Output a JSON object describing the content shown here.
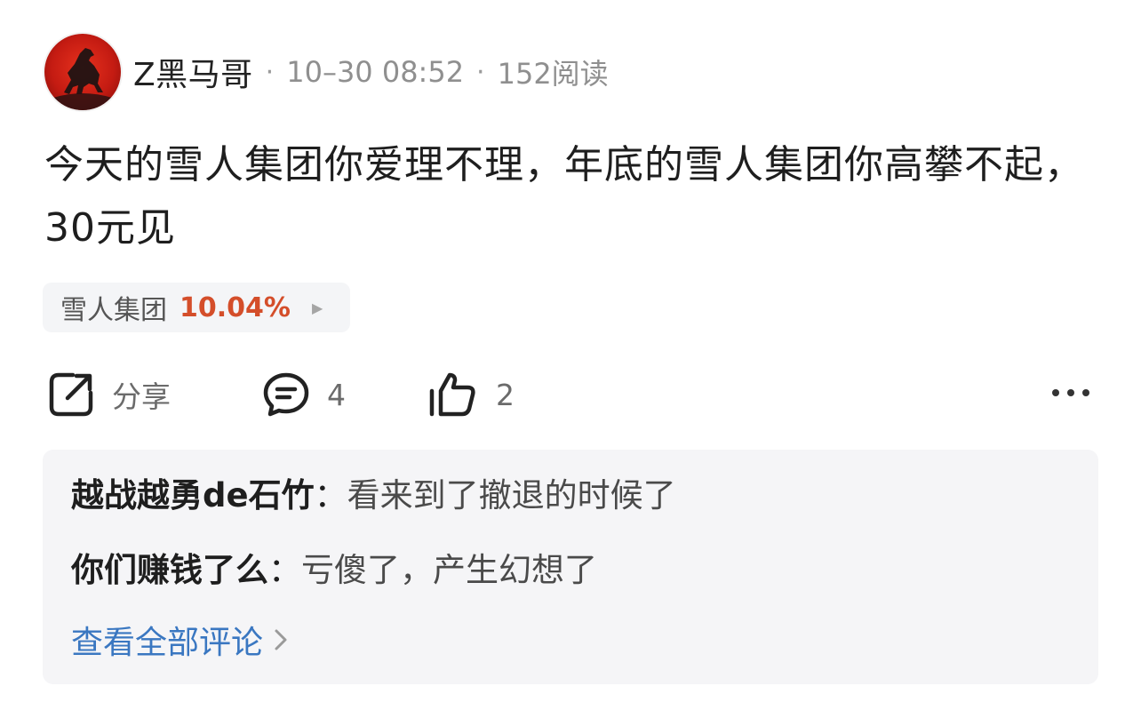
{
  "post": {
    "author": "Z黑马哥",
    "time": "10–30 08:52",
    "reads": "152阅读",
    "text": "今天的雪人集团你爱理不理，年底的雪人集团你高攀不起，30元见"
  },
  "stock": {
    "name": "雪人集团",
    "change": "10.04%"
  },
  "actions": {
    "share_label": "分享",
    "comment_count": "4",
    "like_count": "2"
  },
  "comments": [
    {
      "author": "越战越勇de石竹",
      "text": "看来到了撤退的时候了"
    },
    {
      "author": "你们赚钱了么",
      "text": "亏傻了，产生幻想了"
    }
  ],
  "view_all_label": "查看全部评论",
  "colors": {
    "stock_up": "#d44e2a",
    "link": "#3a77c1",
    "avatar_red": "#c41b12"
  },
  "icons": [
    "share-icon",
    "comment-icon",
    "thumbs-up-icon",
    "more-icon",
    "chevron-right-icon",
    "play-arrow-icon"
  ]
}
